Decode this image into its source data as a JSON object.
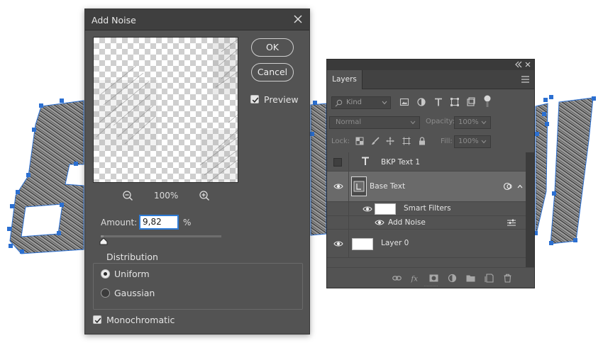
{
  "dialog": {
    "title": "Add Noise",
    "ok_label": "OK",
    "cancel_label": "Cancel",
    "preview_label": "Preview",
    "preview_checked": true,
    "zoom_level": "100%",
    "amount_label": "Amount:",
    "amount_value": "9,82",
    "amount_unit": "%",
    "distribution": {
      "title": "Distribution",
      "options": [
        {
          "label": "Uniform",
          "selected": true
        },
        {
          "label": "Gaussian",
          "selected": false
        }
      ]
    },
    "monochromatic_label": "Monochromatic",
    "monochromatic_checked": true
  },
  "layers_panel": {
    "tab_label": "Layers",
    "kind_placeholder": "Kind",
    "blend_mode": "Normal",
    "opacity_label": "Opacity:",
    "opacity_value": "100%",
    "lock_label": "Lock:",
    "fill_label": "Fill:",
    "fill_value": "100%",
    "layers": [
      {
        "name": "BKP Text 1",
        "type": "text",
        "visible": false
      },
      {
        "name": "Base Text",
        "type": "smart-object",
        "visible": true,
        "selected": true
      },
      {
        "name": "Smart Filters",
        "type": "smart-filters",
        "visible": true
      },
      {
        "name": "Add Noise",
        "type": "filter",
        "visible": true
      },
      {
        "name": "Layer 0",
        "type": "pixel",
        "visible": true
      }
    ]
  },
  "colors": {
    "selection_accent": "#2e7bd6",
    "panel_bg": "#535353",
    "dialog_titlebar": "#3f3f3f"
  }
}
